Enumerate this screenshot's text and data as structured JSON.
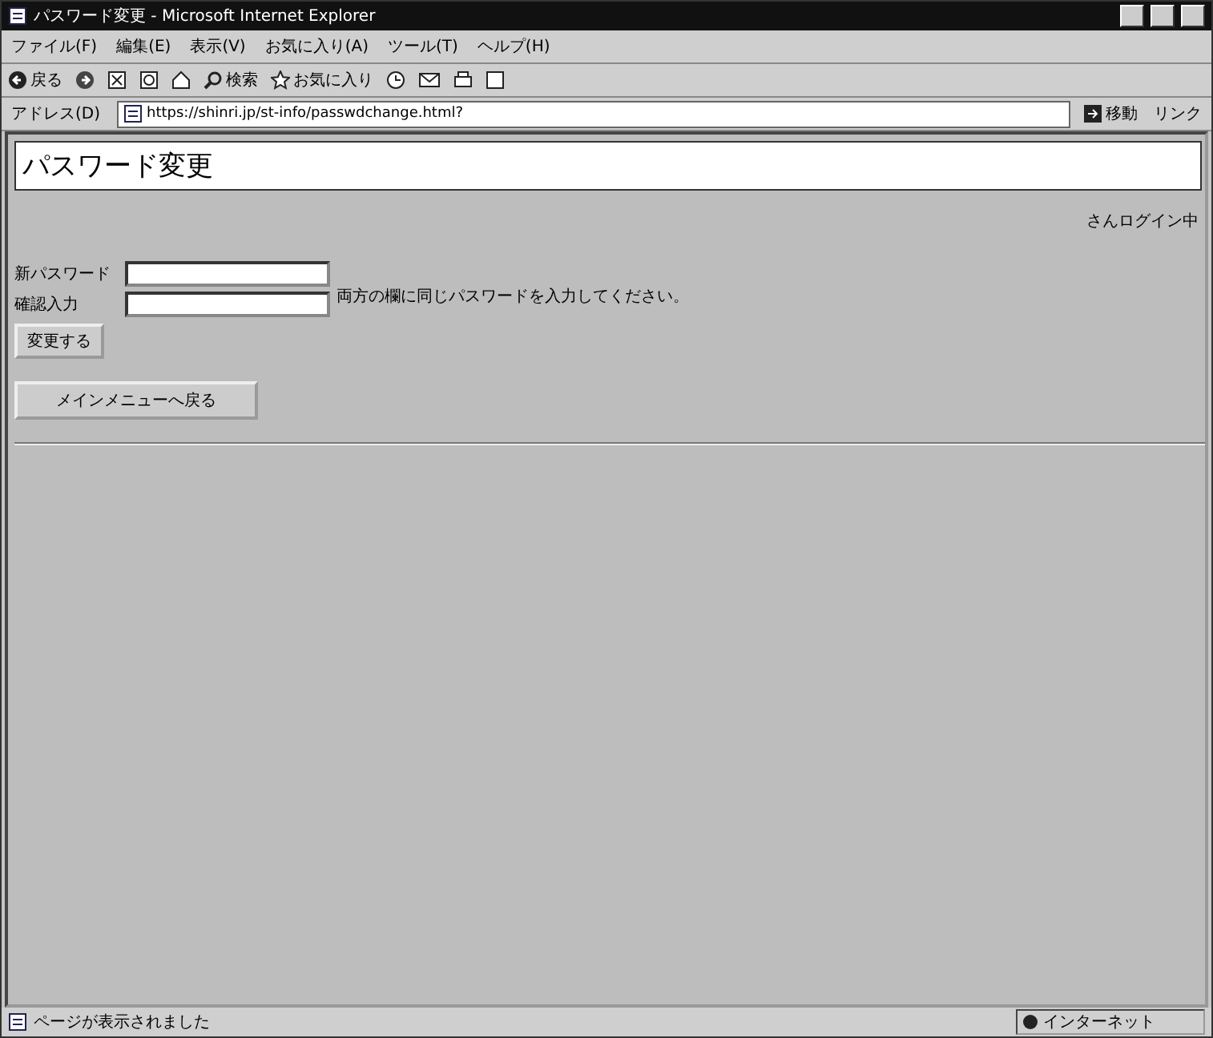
{
  "window": {
    "title": "パスワード変更 - Microsoft Internet Explorer"
  },
  "menu": [
    "ファイル(F)",
    "編集(E)",
    "表示(V)",
    "お気に入り(A)",
    "ツール(T)",
    "ヘルプ(H)"
  ],
  "toolbar": {
    "back": "戻る",
    "search": "検索",
    "favorites": "お気に入り"
  },
  "address_bar": {
    "label": "アドレス(D)",
    "url": "https://shinri.jp/st-info/passwdchange.html?",
    "go": "移動",
    "links": "リンク"
  },
  "page": {
    "heading": "パスワード変更",
    "login_status": "さんログイン中",
    "fields": [
      {
        "label": "新パスワード"
      },
      {
        "label": "確認入力"
      }
    ],
    "hint": "両方の欄に同じパスワードを入力してください。",
    "submit": "変更する",
    "back_to_menu": "メインメニューへ戻る"
  },
  "status_bar": {
    "message": "ページが表示されました",
    "zone": "インターネット"
  }
}
